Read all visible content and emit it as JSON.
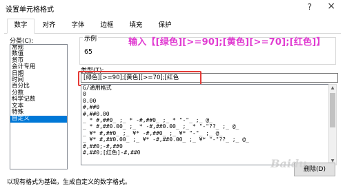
{
  "window": {
    "title": "设置单元格格式",
    "help": "?",
    "close": "×"
  },
  "tabs": [
    "数字",
    "对齐",
    "字体",
    "边框",
    "填充",
    "保护"
  ],
  "category": {
    "label": "分类(C):",
    "items": [
      "常规",
      "数值",
      "货币",
      "会计专用",
      "日期",
      "时间",
      "百分比",
      "分数",
      "科学记数",
      "文本",
      "特殊",
      "自定义"
    ],
    "selected": "自定义"
  },
  "sample": {
    "label": "示例",
    "value": "65"
  },
  "annotation": "输入【[绿色][>=90];[黄色][>=70];[红色]】",
  "type_field": {
    "label": "类型(T):",
    "value": "[绿色][>=90];[黄色][>=70];[红色"
  },
  "format_list": [
    "G/通用格式",
    "0",
    "0.00",
    "#,##0",
    "#,##0.00",
    "_ * #,##0_ ;_ * -#,##0_ ;_ * \"-\"_ ;_ @_",
    "_ * #,##0.00_ ;_ * -#,##0.00_ ;_ * \"-\"??_ ;_ @_",
    "_ ¥* #,##0_ ;_ ¥* -#,##0_ ;_ ¥* \"-\"_ ;_ @_",
    "_ ¥* #,##0.00_ ;_ ¥* -#,##0.00_ ;_ ¥* \"-\"??_ ;_ @_",
    "#,##0;-#,##0",
    "#,##0;[红色]-#,##0"
  ],
  "buttons": {
    "delete": "删除(D)"
  },
  "description": "以现有格式为基础，生成自定义的数字格式。",
  "colors": {
    "selection": "#0078d7",
    "annotation": "#e03ad1",
    "highlight_box": "#e53935"
  }
}
